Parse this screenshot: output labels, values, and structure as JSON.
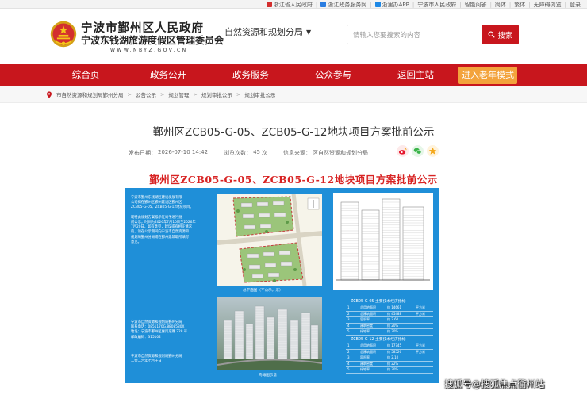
{
  "top_links": [
    {
      "label": "浙江省人民政府",
      "icon": "gov-emblem-mini-icon"
    },
    {
      "label": "浙江政务服务网",
      "icon": "zhejiang-service-icon"
    },
    {
      "label": "浙里办APP",
      "icon": "zheliban-app-icon"
    },
    {
      "label": "宁波市人民政府",
      "icon": ""
    },
    {
      "label": "智能问答",
      "icon": ""
    },
    {
      "label": "简体",
      "icon": ""
    },
    {
      "label": "繁体",
      "icon": ""
    },
    {
      "label": "无障碍浏览",
      "icon": ""
    },
    {
      "label": "登录",
      "icon": ""
    }
  ],
  "header": {
    "brand_line1": "宁波市鄞州区人民政府",
    "brand_line2": "宁波东钱湖旅游度假区管理委员会",
    "brand_url": "WWW.NBYZ.GOV.CN",
    "department": "自然资源和规划分局",
    "department_caret": "▼",
    "search_placeholder": "请输入您要搜索的内容",
    "search_button": "搜索"
  },
  "nav": {
    "items": [
      "综合页",
      "政务公开",
      "政务服务",
      "公众参与",
      "返回主站"
    ],
    "elder_mode": "进入老年模式"
  },
  "breadcrumb": [
    "市自然资源和规划局鄞州分局",
    "公告公示",
    "规划管理",
    "规划审批公示",
    "规划审批公示"
  ],
  "article": {
    "title": "鄞州区ZCB05-G-05、ZCB05-G-12地块项目方案批前公示",
    "publish_label": "发布日期：",
    "publish_date": "2026-07-10 14:42",
    "views_label": "浏览次数：",
    "views": "45",
    "views_unit": "次",
    "source_label": "信息来源：",
    "source": "区自然资源和规划分局"
  },
  "share": [
    {
      "name": "weibo-share-icon",
      "color": "#e6162d"
    },
    {
      "name": "wechat-share-icon",
      "color": "#3bb44a"
    },
    {
      "name": "favorite-share-icon",
      "color": "#f4a81c"
    }
  ],
  "poster": {
    "title": "鄞州区ZCB05-G-05、ZCB05-G-12地块项目方案批前公示",
    "intro_lines": [
      "宁波市鄞州东钱湖区建设发展有限",
      "公司拟在鄞州区鄞州建设区鄞州区",
      "ZCB05-G-05、ZCB05-G-12地块项目。",
      "",
      "现特此规划方案报示征询予进行批",
      "前公示，时间为2026年7月10日至2026年",
      "7月20日，如有意见，建议或有相征请求",
      "的，请在公示期间向宁波市自然资源和",
      "规划局鄞州分局或在鄞州建筑取所填写",
      "意见。"
    ],
    "contact_lines": [
      "宁波市自然资源和规划局鄞州分局",
      "联系电话：0851170G.8808580X",
      "地址：宁波市鄞州区惠风东路 228 号",
      "邮政编码：315102"
    ],
    "sign_lines": [
      "宁波市自然资源和规划局鄞州分局",
      "二零二六年七月十日"
    ],
    "plan_caption": "总平面图（不公示，米）",
    "aerial_caption": "鸟瞰图示意",
    "table1_title": "ZCB05-G-05 主要技术经济指标",
    "table1_rows": [
      [
        "1",
        "总用地面积",
        "约 14661",
        "平方米"
      ],
      [
        "2",
        "总建筑面积",
        "约 45488",
        "平方米"
      ],
      [
        "3",
        "容积率",
        "约 2.60",
        ""
      ],
      [
        "4",
        "建筑密度",
        "约 20%",
        ""
      ],
      [
        "5",
        "绿地率",
        "约 30%",
        ""
      ]
    ],
    "table2_title": "ZCB05-G-12 主要技术经济指标",
    "table2_rows": [
      [
        "1",
        "总用地面积",
        "约 17745",
        "平方米"
      ],
      [
        "2",
        "总建筑面积",
        "约 58526",
        "平方米"
      ],
      [
        "3",
        "容积率",
        "约 2.10",
        ""
      ],
      [
        "4",
        "建筑密度",
        "约 22%",
        ""
      ],
      [
        "5",
        "绿地率",
        "约 30%",
        ""
      ]
    ]
  },
  "watermark": "搜狐号@搜狐焦点衢州站",
  "colors": {
    "brand_red": "#c8161d",
    "elder_orange": "#f3a33c",
    "poster_blue": "#1f8fd8",
    "poster_title_red": "#d82323"
  }
}
